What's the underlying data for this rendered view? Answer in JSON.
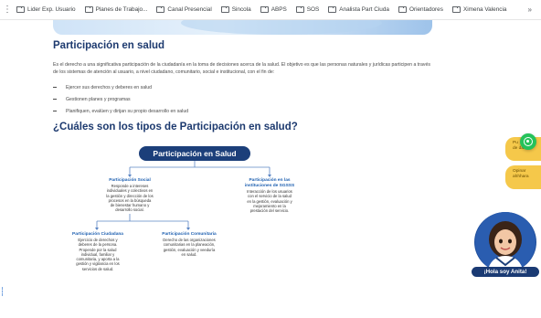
{
  "bookmarks": {
    "items": [
      {
        "label": "Lider Exp. Usuario"
      },
      {
        "label": "Planes de Trabajo..."
      },
      {
        "label": "Canal Presencial"
      },
      {
        "label": "Sincola"
      },
      {
        "label": "ABPS"
      },
      {
        "label": "SOS"
      },
      {
        "label": "Analista Part Ciuda"
      },
      {
        "label": "Orientadores"
      },
      {
        "label": "Ximena Valencia"
      }
    ],
    "more": "»"
  },
  "content": {
    "title": "Participación en salud",
    "intro": "Es el derecho a una significativa participación de la ciudadanía en la toma de decisiones acerca de la salud.  El objetivo es que las personas naturales y jurídicas participen a través de los sistemas de atención al usuario, a nivel ciudadano, comunitario, social e institucional, con el fin de:",
    "bullets": [
      "Ejercer sus derechos y deberes en salud",
      "Gestionen planes y programas",
      "Planifiquen, evalúen y dirijan su propio desarrollo en salud"
    ],
    "subtitle": "¿Cuáles son los tipos de Participación en salud?"
  },
  "diagram": {
    "root": "Participación en Salud",
    "social": {
      "title": "Participación Social",
      "desc": [
        "Responde a intereses",
        "individuales y colectivos en",
        "la gestión y dirección de los",
        "procesos en la búsqueda",
        "de bienestar humano y",
        "desarrollo social."
      ]
    },
    "instituciones": {
      "title": [
        "Participación en las",
        "instituciones de SGSSS"
      ],
      "desc": [
        "Interacción de los usuarios",
        "con el servicio de la salud",
        "en la gestión, evaluación y",
        "mejoramiento en la",
        "prestación del servicio."
      ]
    },
    "ciudadana": {
      "title": "Participación Ciudadana",
      "desc": [
        "Ejercicio de derechos y",
        "deberes de la persona.",
        "Propende por la salud",
        "individual, familiar y",
        "comunitaria, y aporta a la",
        "gestión y vigilancia en los",
        "servicios de salud."
      ]
    },
    "comunitaria": {
      "title": "Participación Comunitaria",
      "desc": [
        "Derecho de las organizaciones",
        "comunitarias en la planeación,",
        "gestión, evaluación y veeduría",
        "en salud."
      ]
    }
  },
  "floating": {
    "tab1": [
      "Pu",
      "de datos"
    ],
    "tab2": [
      "Opinar",
      "ahhhara"
    ],
    "assistant_label": "¡Hola soy Anita!"
  },
  "colors": {
    "primary_navy": "#1c3f7a",
    "node_blue": "#1d5fb0",
    "accent_yellow": "#f5c84a",
    "whatsapp_green": "#25c25a"
  }
}
